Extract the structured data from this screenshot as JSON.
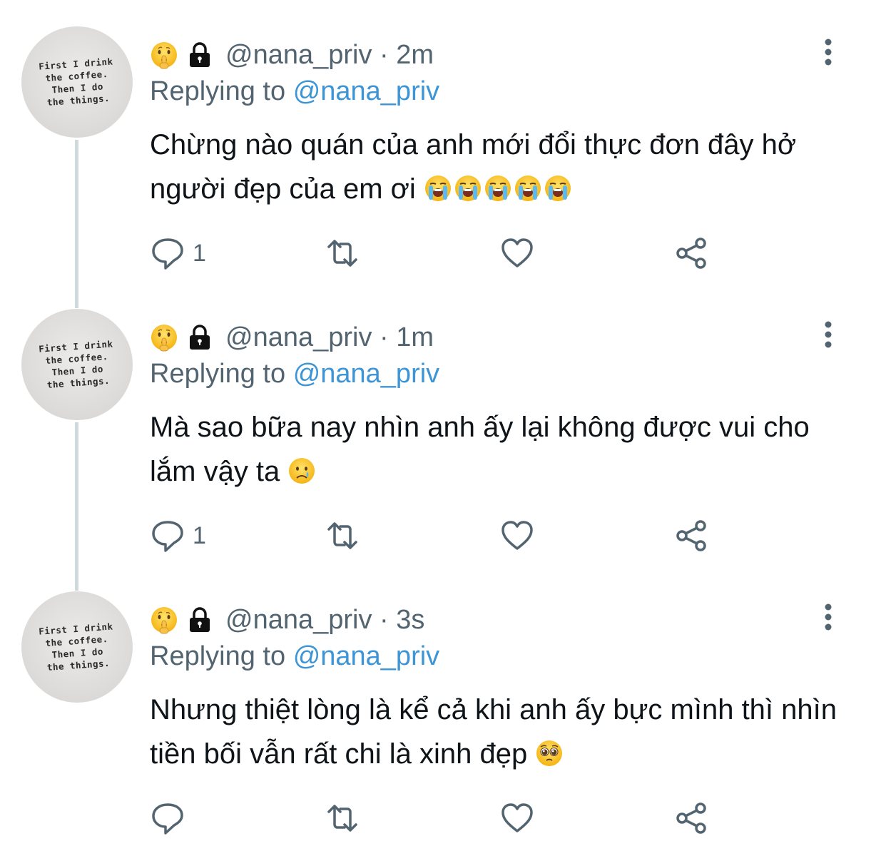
{
  "tweets": [
    {
      "handle": "@nana_priv",
      "separator": "·",
      "time": "2m",
      "replying_prefix": "Replying to",
      "replying_handle": "@nana_priv",
      "text": "Chừng nào quán của anh mới đổi thực đơn đây hở người đẹp của em ơi",
      "emojis": [
        "loudly-crying-face",
        "loudly-crying-face",
        "loudly-crying-face",
        "loudly-crying-face",
        "loudly-crying-face"
      ],
      "reply_count": "1",
      "avatar_text": "First I drink\nthe coffee.\nThen I do\nthe things."
    },
    {
      "handle": "@nana_priv",
      "separator": "·",
      "time": "1m",
      "replying_prefix": "Replying to",
      "replying_handle": "@nana_priv",
      "text": "Mà sao bữa nay nhìn anh ấy lại không được vui cho lắm vậy ta",
      "emojis": [
        "crying-face"
      ],
      "reply_count": "1",
      "avatar_text": "First I drink\nthe coffee.\nThen I do\nthe things."
    },
    {
      "handle": "@nana_priv",
      "separator": "·",
      "time": "3s",
      "replying_prefix": "Replying to",
      "replying_handle": "@nana_priv",
      "text": "Nhưng thiệt lòng là kể cả khi anh ấy bực mình thì nhìn tiền bối vẫn rất chi là xinh đẹp",
      "emojis": [
        "pleading-face"
      ],
      "reply_count": "",
      "avatar_text": "First I drink\nthe coffee.\nThen I do\nthe things."
    }
  ],
  "icons": {
    "badge": "shushing-face-icon",
    "lock": "lock-icon",
    "more": "more-vertical-icon",
    "reply": "reply-icon",
    "retweet": "retweet-icon",
    "like": "heart-icon",
    "share": "share-icon"
  },
  "colors": {
    "link": "#3d95d6",
    "secondary_text": "#536471",
    "thread_line": "#cfd9de"
  }
}
